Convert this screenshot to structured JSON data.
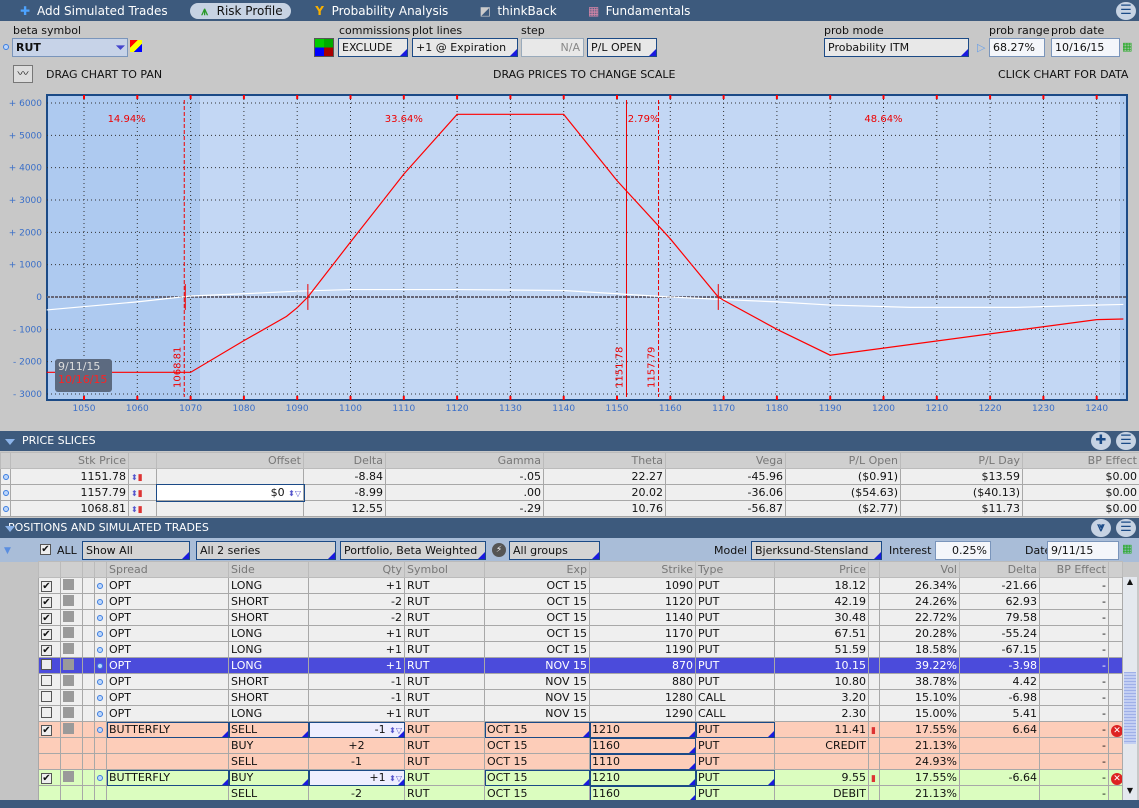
{
  "tabs": [
    {
      "label": "Add Simulated Trades",
      "icon": "plus-icon"
    },
    {
      "label": "Risk Profile",
      "icon": "risk-profile-icon",
      "active": true
    },
    {
      "label": "Probability Analysis",
      "icon": "probability-icon"
    },
    {
      "label": "thinkBack",
      "icon": "thinkback-icon"
    },
    {
      "label": "Fundamentals",
      "icon": "fundamentals-icon"
    }
  ],
  "controls": {
    "beta_symbol_label": "beta symbol",
    "beta_symbol": "RUT",
    "commissions_label": "commissions",
    "commissions": "EXCLUDE",
    "plot_lines_label": "plot lines",
    "plot_lines": "+1 @ Expiration",
    "step_label": "step",
    "step": "N/A",
    "pl_mode": "P/L OPEN",
    "prob_mode_label": "prob mode",
    "prob_mode": "Probability ITM",
    "prob_range_label": "prob range",
    "prob_range": "68.27%",
    "prob_date_label": "prob date",
    "prob_date": "10/16/15"
  },
  "hints": {
    "pan": "DRAG CHART TO PAN",
    "scale": "DRAG PRICES TO CHANGE SCALE",
    "click": "CLICK CHART FOR DATA"
  },
  "chart_data": {
    "type": "line",
    "xlim": [
      1043,
      1245
    ],
    "ylim": [
      -3000,
      6000
    ],
    "x_ticks": [
      "1050",
      "1060",
      "1070",
      "1080",
      "1090",
      "1100",
      "1110",
      "1120",
      "1130",
      "1140",
      "1150",
      "1160",
      "1170",
      "1180",
      "1190",
      "1200",
      "1210",
      "1220",
      "1230",
      "1240"
    ],
    "y_ticks": [
      "+ 6000",
      "+ 5000",
      "+ 4000",
      "+ 3000",
      "+ 2000",
      "+ 1000",
      "0",
      "- 1000",
      "- 2000",
      "- 3000"
    ],
    "grid": true,
    "series": [
      {
        "name": "10/16/15",
        "color": "#ff0000",
        "points": [
          [
            1043,
            -2330
          ],
          [
            1070,
            -2330
          ],
          [
            1080,
            -1350
          ],
          [
            1088,
            -600
          ],
          [
            1090,
            -330
          ],
          [
            1092,
            0
          ],
          [
            1100,
            1700
          ],
          [
            1110,
            3800
          ],
          [
            1120,
            5650
          ],
          [
            1140,
            5650
          ],
          [
            1150,
            3600
          ],
          [
            1160,
            1800
          ],
          [
            1169,
            0
          ],
          [
            1170,
            -100
          ],
          [
            1180,
            -1000
          ],
          [
            1190,
            -1800
          ],
          [
            1240,
            -700
          ],
          [
            1245,
            -680
          ]
        ]
      },
      {
        "name": "9/11/15",
        "color": "#ffffff",
        "points": [
          [
            1043,
            -400
          ],
          [
            1060,
            -150
          ],
          [
            1070,
            30
          ],
          [
            1080,
            100
          ],
          [
            1090,
            180
          ],
          [
            1100,
            230
          ],
          [
            1120,
            230
          ],
          [
            1140,
            200
          ],
          [
            1150,
            100
          ],
          [
            1160,
            0
          ],
          [
            1170,
            -80
          ],
          [
            1180,
            -150
          ],
          [
            1190,
            -250
          ],
          [
            1205,
            -320
          ],
          [
            1225,
            -320
          ],
          [
            1240,
            -250
          ],
          [
            1245,
            -230
          ]
        ]
      }
    ],
    "price_lines": [
      {
        "value": 1068.81,
        "label": "1068.81"
      },
      {
        "value": 1151.78,
        "label": "1151.78"
      },
      {
        "value": 1157.79,
        "label": "1157.79"
      }
    ],
    "prob_labels": [
      {
        "x": 1058,
        "label": "14.94%"
      },
      {
        "x": 1110,
        "label": "33.64%"
      },
      {
        "x": 1155,
        "label": "2.79%"
      },
      {
        "x": 1200,
        "label": "48.64%"
      }
    ],
    "breakevens": [
      1069,
      1092,
      1169
    ],
    "legend": {
      "placement": "bottom-left",
      "entries": [
        "9/11/15",
        "10/16/15"
      ]
    }
  },
  "price_slices": {
    "title": "PRICE SLICES",
    "columns": [
      "Stk Price",
      "Offset",
      "Delta",
      "Gamma",
      "Theta",
      "Vega",
      "P/L Open",
      "P/L Day",
      "BP Effect"
    ],
    "rows": [
      [
        "1151.78",
        "",
        "-8.84",
        "-.05",
        "22.27",
        "-45.96",
        "($0.91)",
        "$13.59",
        "$0.00"
      ],
      [
        "1157.79",
        "$0",
        "-8.99",
        ".00",
        "20.02",
        "-36.06",
        "($54.63)",
        "($40.13)",
        "$0.00"
      ],
      [
        "1068.81",
        "",
        "12.55",
        "-.29",
        "10.76",
        "-56.87",
        "($2.77)",
        "$11.73",
        "$0.00"
      ]
    ]
  },
  "positions": {
    "title": "POSITIONS AND SIMULATED TRADES",
    "all_label": "ALL",
    "show": "Show All",
    "series": "All 2 series",
    "weighting": "Portfolio, Beta Weighted",
    "groups": "All groups",
    "model_label": "Model",
    "model": "Bjerksund-Stensland",
    "interest_label": "Interest",
    "interest": "0.25%",
    "date_label": "Date",
    "date": "9/11/15",
    "columns": [
      "Spread",
      "Side",
      "Qty",
      "Symbol",
      "Exp",
      "Strike",
      "Type",
      "Price",
      "Vol",
      "Delta",
      "BP Effect"
    ],
    "rows": [
      {
        "c": true,
        "spread": "OPT",
        "side": "LONG",
        "qty": "+1",
        "sym": "RUT",
        "exp": "OCT 15",
        "strike": "1090",
        "type": "PUT",
        "price": "18.12",
        "vol": "26.34%",
        "delta": "-21.66",
        "bp": "-"
      },
      {
        "c": true,
        "spread": "OPT",
        "side": "SHORT",
        "qty": "-2",
        "sym": "RUT",
        "exp": "OCT 15",
        "strike": "1120",
        "type": "PUT",
        "price": "42.19",
        "vol": "24.26%",
        "delta": "62.93",
        "bp": "-"
      },
      {
        "c": true,
        "spread": "OPT",
        "side": "SHORT",
        "qty": "-2",
        "sym": "RUT",
        "exp": "OCT 15",
        "strike": "1140",
        "type": "PUT",
        "price": "30.48",
        "vol": "22.72%",
        "delta": "79.58",
        "bp": "-"
      },
      {
        "c": true,
        "spread": "OPT",
        "side": "LONG",
        "qty": "+1",
        "sym": "RUT",
        "exp": "OCT 15",
        "strike": "1170",
        "type": "PUT",
        "price": "67.51",
        "vol": "20.28%",
        "delta": "-55.24",
        "bp": "-"
      },
      {
        "c": true,
        "spread": "OPT",
        "side": "LONG",
        "qty": "+1",
        "sym": "RUT",
        "exp": "OCT 15",
        "strike": "1190",
        "type": "PUT",
        "price": "51.59",
        "vol": "18.58%",
        "delta": "-67.15",
        "bp": "-"
      },
      {
        "c": false,
        "sel": true,
        "spread": "OPT",
        "side": "LONG",
        "qty": "+1",
        "sym": "RUT",
        "exp": "NOV 15",
        "strike": "870",
        "type": "PUT",
        "price": "10.15",
        "vol": "39.22%",
        "delta": "-3.98",
        "bp": "-"
      },
      {
        "c": false,
        "spread": "OPT",
        "side": "SHORT",
        "qty": "-1",
        "sym": "RUT",
        "exp": "NOV 15",
        "strike": "880",
        "type": "PUT",
        "price": "10.80",
        "vol": "38.78%",
        "delta": "4.42",
        "bp": "-"
      },
      {
        "c": false,
        "spread": "OPT",
        "side": "SHORT",
        "qty": "-1",
        "sym": "RUT",
        "exp": "NOV 15",
        "strike": "1280",
        "type": "CALL",
        "price": "3.20",
        "vol": "15.10%",
        "delta": "-6.98",
        "bp": "-"
      },
      {
        "c": false,
        "spread": "OPT",
        "side": "LONG",
        "qty": "+1",
        "sym": "RUT",
        "exp": "NOV 15",
        "strike": "1290",
        "type": "CALL",
        "price": "2.30",
        "vol": "15.00%",
        "delta": "5.41",
        "bp": "-"
      },
      {
        "c": true,
        "sim": "pink",
        "spread": "BUTTERFLY",
        "side": "SELL",
        "qty": "-1",
        "sym": "RUT",
        "exp": "OCT 15",
        "strike": "1210",
        "type": "PUT",
        "price": "11.41",
        "vol": "17.55%",
        "delta": "6.64",
        "bp": "-",
        "x": true
      },
      {
        "sim": "pink",
        "leg": true,
        "spread": "",
        "side": "BUY",
        "qty": "+2",
        "sym": "RUT",
        "exp": "OCT 15",
        "strike": "1160",
        "type": "PUT",
        "price": "CREDIT",
        "vol": "21.13%",
        "delta": "",
        "bp": "-"
      },
      {
        "sim": "pink",
        "leg": true,
        "spread": "",
        "side": "SELL",
        "qty": "-1",
        "sym": "RUT",
        "exp": "OCT 15",
        "strike": "1110",
        "type": "PUT",
        "price": "",
        "vol": "24.93%",
        "delta": "",
        "bp": "-"
      },
      {
        "c": true,
        "sim": "green",
        "spread": "BUTTERFLY",
        "side": "BUY",
        "qty": "+1",
        "sym": "RUT",
        "exp": "OCT 15",
        "strike": "1210",
        "type": "PUT",
        "price": "9.55",
        "vol": "17.55%",
        "delta": "-6.64",
        "bp": "-",
        "x": true
      },
      {
        "sim": "green",
        "leg": true,
        "spread": "",
        "side": "SELL",
        "qty": "-2",
        "sym": "RUT",
        "exp": "OCT 15",
        "strike": "1160",
        "type": "PUT",
        "price": "DEBIT",
        "vol": "21.13%",
        "delta": "",
        "bp": "-"
      }
    ]
  }
}
